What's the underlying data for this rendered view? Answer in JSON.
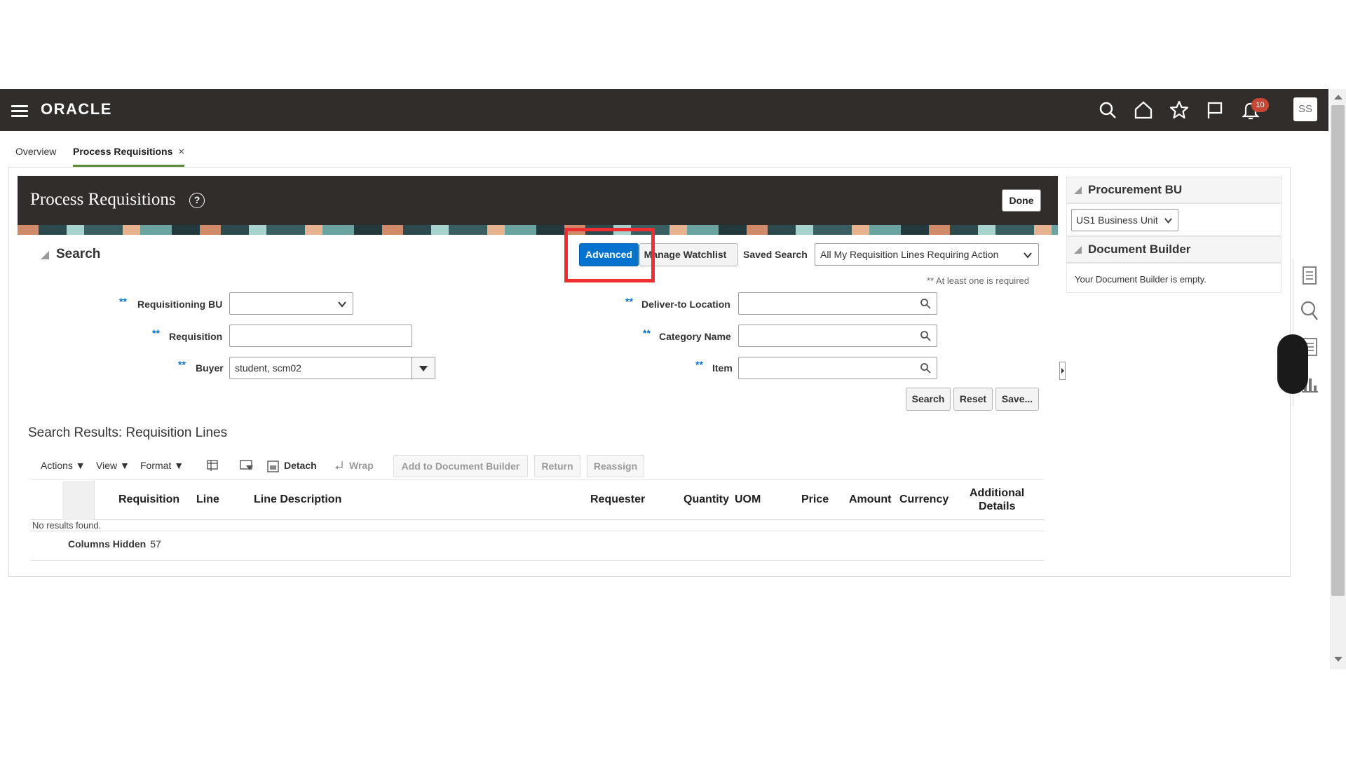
{
  "header": {
    "logo": "ORACLE",
    "notification_count": "10",
    "avatar_initials": "SS"
  },
  "tabs": [
    {
      "label": "Overview"
    },
    {
      "label": "Process Requisitions",
      "close": "×"
    }
  ],
  "page": {
    "title": "Process Requisitions",
    "help": "?",
    "done_label": "Done"
  },
  "search": {
    "title": "Search",
    "advanced_label": "Advanced",
    "manage_watchlist_label": "Manage Watchlist",
    "saved_search_label": "Saved Search",
    "saved_search_value": "All My Requisition Lines Requiring Action",
    "required_note": "** At least one is required",
    "required_mark": "**",
    "fields": {
      "requisitioning_bu": {
        "label": "Requisitioning BU",
        "value": ""
      },
      "requisition": {
        "label": "Requisition",
        "value": ""
      },
      "buyer": {
        "label": "Buyer",
        "value": "student, scm02"
      },
      "deliver_to_location": {
        "label": "Deliver-to Location",
        "value": ""
      },
      "category_name": {
        "label": "Category Name",
        "value": ""
      },
      "item": {
        "label": "Item",
        "value": ""
      }
    },
    "search_btn": "Search",
    "reset_btn": "Reset",
    "save_btn": "Save..."
  },
  "results": {
    "title": "Search Results: Requisition Lines",
    "toolbar": {
      "actions": "Actions",
      "view": "View",
      "format": "Format",
      "detach": "Detach",
      "wrap": "Wrap",
      "add_to_doc_builder": "Add to Document Builder",
      "return": "Return",
      "reassign": "Reassign"
    },
    "columns": [
      "Requisition",
      "Line",
      "Line Description",
      "Requester",
      "Quantity",
      "UOM",
      "Price",
      "Amount",
      "Currency",
      "Additional",
      "Details"
    ],
    "empty_text": "No results found.",
    "columns_hidden_label": "Columns Hidden",
    "columns_hidden_count": "57"
  },
  "right_panel": {
    "procurement_bu_title": "Procurement BU",
    "procurement_bu_value": "US1 Business Unit",
    "document_builder_title": "Document Builder",
    "document_builder_text": "Your Document Builder is empty."
  },
  "colors": {
    "header_bg": "#312d2a",
    "primary": "#0572ce",
    "highlight": "#ef2f2f",
    "badge": "#c74634"
  }
}
